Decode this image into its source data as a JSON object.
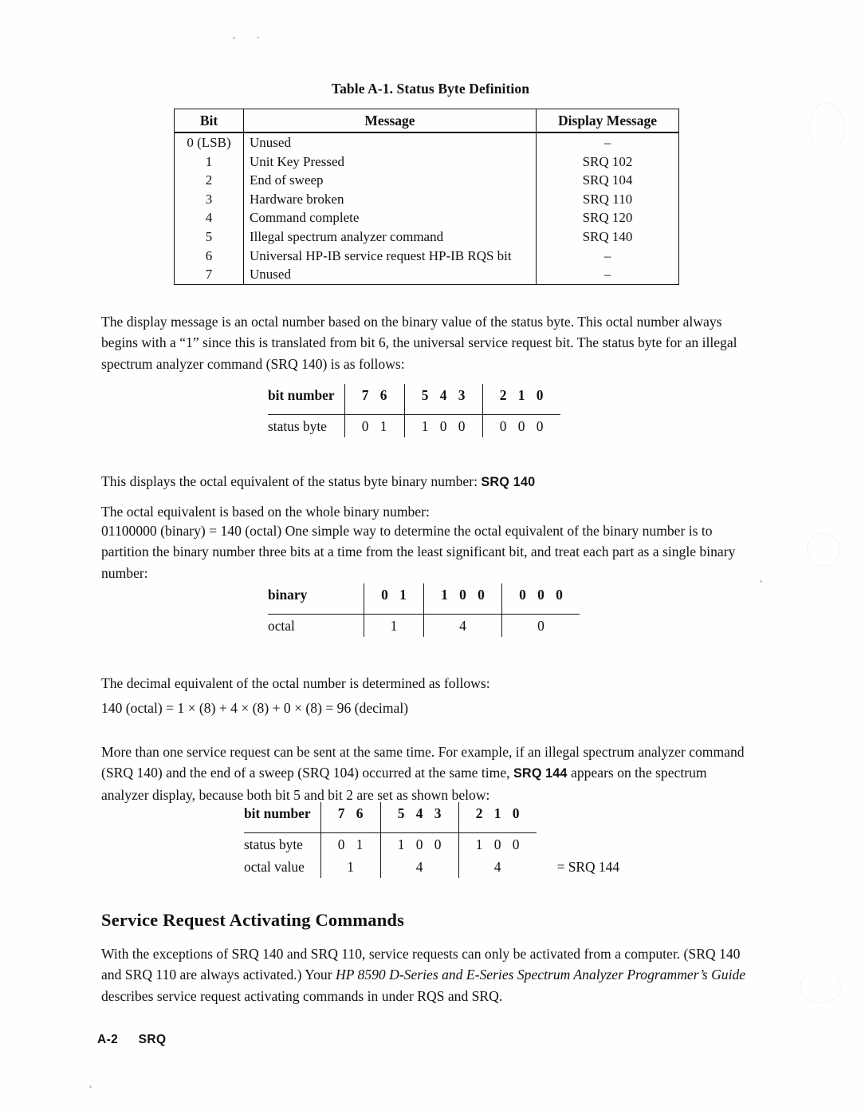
{
  "table": {
    "title": "Table A-1. Status Byte Definition",
    "headers": [
      "Bit",
      "Message",
      "Display Message"
    ],
    "rows": [
      {
        "bit": "0 (LSB)",
        "message": "Unused",
        "display": "–"
      },
      {
        "bit": "1",
        "message": "Unit Key Pressed",
        "display": "SRQ 102"
      },
      {
        "bit": "2",
        "message": "End of sweep",
        "display": "SRQ 104"
      },
      {
        "bit": "3",
        "message": "Hardware broken",
        "display": "SRQ 110"
      },
      {
        "bit": "4",
        "message": "Command complete",
        "display": "SRQ 120"
      },
      {
        "bit": "5",
        "message": "Illegal spectrum analyzer command",
        "display": "SRQ 140"
      },
      {
        "bit": "6",
        "message": "Universal HP-IB service request HP-IB RQS bit",
        "display": "–"
      },
      {
        "bit": "7",
        "message": "Unused",
        "display": "–"
      }
    ]
  },
  "paragraphs": {
    "p1": "The display message is an octal number based on the binary value of the status byte. This octal number always begins with a “1” since this is translated from bit 6, the universal service request bit. The status byte for an illegal spectrum analyzer command (SRQ 140) is as follows:",
    "p2_pre": "This displays the octal equivalent of the status byte binary number:",
    "p2_code": "SRQ 140",
    "p3": "The octal equivalent is based on the whole binary number:",
    "p4": "01100000 (binary) = 140 (octal) One simple way to determine the octal equivalent of the binary number is to partition the binary number three bits at a time from the least significant bit, and treat each part as a single binary number:",
    "p5": "The decimal equivalent of the octal number is determined as follows:",
    "p6": "140 (octal) = 1 × (8) + 4 × (8) + 0 × (8) = 96 (decimal)",
    "p7_a": "More than one service request can be sent at the same time. For example, if an illegal spectrum analyzer command (SRQ 140) and the end of a sweep (SRQ 104) occurred at the same time,",
    "p7_code1": "SRQ",
    "p7_code2": "144",
    "p7_b": "appears on the spectrum analyzer display, because both bit 5 and bit 2 are set as shown below:"
  },
  "diagram1": {
    "row1_label": "bit number",
    "row2_label": "status byte",
    "row1_groups": [
      [
        "7",
        "6"
      ],
      [
        "5",
        "4",
        "3"
      ],
      [
        "2",
        "1",
        "0"
      ]
    ],
    "row2_groups": [
      [
        "0",
        "1"
      ],
      [
        "1",
        "0",
        "0"
      ],
      [
        "0",
        "0",
        "0"
      ]
    ]
  },
  "diagram2": {
    "row1_label": "binary",
    "row2_label": "octal",
    "row1_groups": [
      [
        "0",
        "1"
      ],
      [
        "1",
        "0",
        "0"
      ],
      [
        "0",
        "0",
        "0"
      ]
    ],
    "row2_values": [
      "1",
      "4",
      "0"
    ]
  },
  "diagram3": {
    "row1_label": "bit number",
    "row2_label": "status byte",
    "row3_label": "octal value",
    "row1_groups": [
      [
        "7",
        "6"
      ],
      [
        "5",
        "4",
        "3"
      ],
      [
        "2",
        "1",
        "0"
      ]
    ],
    "row2_groups": [
      [
        "0",
        "1"
      ],
      [
        "1",
        "0",
        "0"
      ],
      [
        "1",
        "0",
        "0"
      ]
    ],
    "row3_values": [
      "1",
      "4",
      "4"
    ],
    "result": "= SRQ 144"
  },
  "section": {
    "heading": "Service Request Activating Commands",
    "body_a": "With the exceptions of SRQ 140 and SRQ 110, service requests can only be activated from a computer.  (SRQ 140 and SRQ 110 are always activated.)  Your",
    "body_italic": "HP 8590 D-Series and E-Series Spectrum Analyzer Programmer’s Guide",
    "body_b": "describes service request activating commands in under RQS and SRQ."
  },
  "footer": {
    "page": "A-2",
    "chapter": "SRQ"
  }
}
